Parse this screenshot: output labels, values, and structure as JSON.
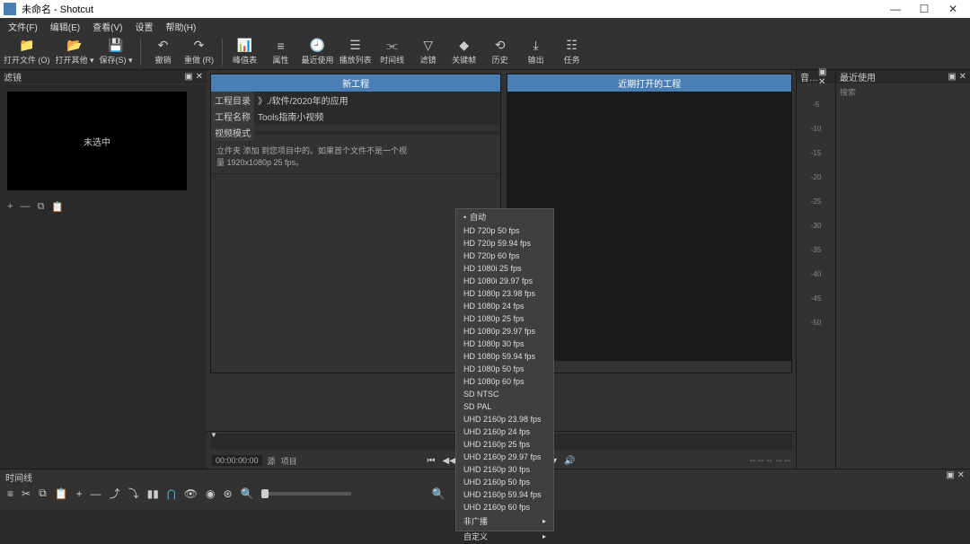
{
  "window": {
    "title": "未命名 - Shotcut"
  },
  "menubar": [
    "文件(F)",
    "编辑(E)",
    "查看(V)",
    "设置",
    "帮助(H)"
  ],
  "toolbar": [
    {
      "label": "打开文件 (O)",
      "icon": "folder"
    },
    {
      "label": "打开其他 ▾",
      "icon": "folder2"
    },
    {
      "label": "保存(S) ▾",
      "icon": "save"
    },
    {
      "label": "撤销",
      "icon": "undo"
    },
    {
      "label": "重做 (R)",
      "icon": "redo"
    },
    {
      "label": "峰值表",
      "icon": "meter"
    },
    {
      "label": "属性",
      "icon": "props"
    },
    {
      "label": "最近使用",
      "icon": "recent"
    },
    {
      "label": "播放列表",
      "icon": "playlist"
    },
    {
      "label": "时间线",
      "icon": "timeline"
    },
    {
      "label": "滤镜",
      "icon": "filter"
    },
    {
      "label": "关键帧",
      "icon": "keyframe"
    },
    {
      "label": "历史",
      "icon": "history"
    },
    {
      "label": "输出",
      "icon": "export"
    },
    {
      "label": "任务",
      "icon": "jobs"
    }
  ],
  "leftPanel": {
    "title": "滤镜",
    "preview": "未选中"
  },
  "project": {
    "newTitle": "新工程",
    "recentTitle": "近期打开的工程",
    "dirLabel": "工程目录",
    "dirValue": "》./软件/2020年的应用",
    "nameLabel": "工程名称",
    "nameValue": "Tools指南小视频",
    "modeLabel": "视频模式",
    "hintPart1": "立件夹 添加 到您项目中的。如果首个文件不是一个视",
    "hintPart2": "量 1920x1080p 25 fps。"
  },
  "videoModes": [
    "自动",
    "HD 720p 50 fps",
    "HD 720p 59.94 fps",
    "HD 720p 60 fps",
    "HD 1080i 25 fps",
    "HD 1080i 29.97 fps",
    "HD 1080p 23.98 fps",
    "HD 1080p 24 fps",
    "HD 1080p 25 fps",
    "HD 1080p 29.97 fps",
    "HD 1080p 30 fps",
    "HD 1080p 59.94 fps",
    "HD 1080p 50 fps",
    "HD 1080p 60 fps",
    "SD NTSC",
    "SD PAL",
    "UHD 2160p 23.98 fps",
    "UHD 2160p 24 fps",
    "UHD 2160p 25 fps",
    "UHD 2160p 29.97 fps",
    "UHD 2160p 30 fps",
    "UHD 2160p 50 fps",
    "UHD 2160p 59.94 fps",
    "UHD 2160p 60 fps",
    "非广播",
    "自定义"
  ],
  "meter": {
    "ticks": [
      "-5",
      "-10",
      "-15",
      "-20",
      "-25",
      "-30",
      "-35",
      "-40",
      "-45",
      "-50"
    ],
    "header": "音…"
  },
  "recentPanel": {
    "title": "最近使用",
    "search": "搜索"
  },
  "player": {
    "timecode": "00:00:00:00",
    "pos": "------",
    "tabSource": "源",
    "tabProject": "项目"
  },
  "timeline": {
    "title": "时间线"
  }
}
